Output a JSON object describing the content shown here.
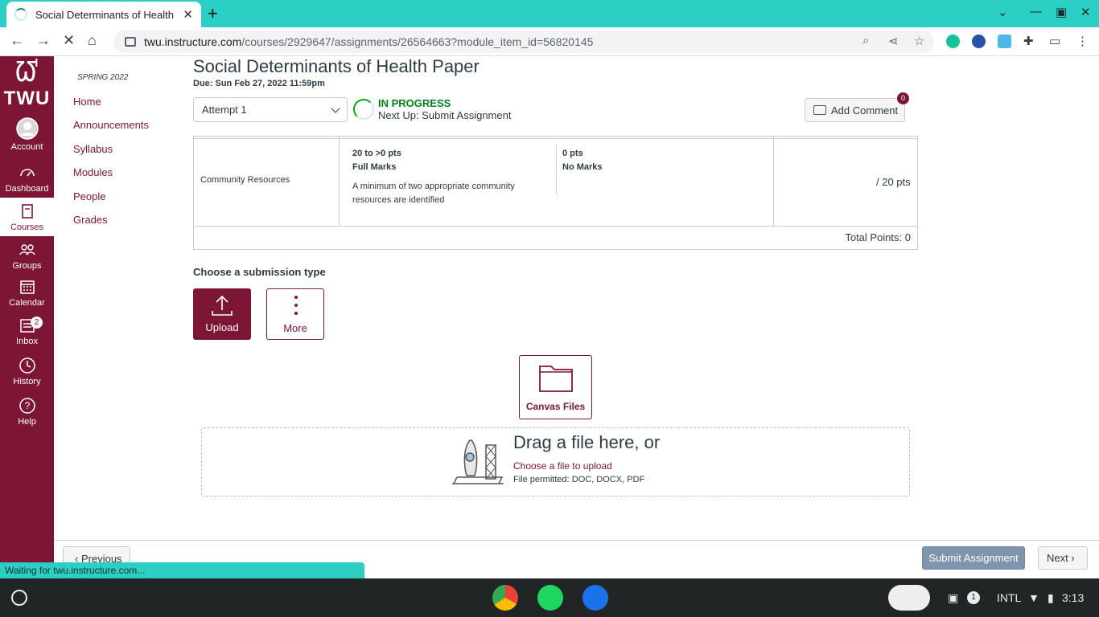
{
  "browser": {
    "tab_title": "Social Determinants of Health P",
    "url_host": "twu.instructure.com",
    "url_path": "/courses/2929647/assignments/26564663?module_item_id=56820145",
    "status_text": "Waiting for twu.instructure.com..."
  },
  "global_nav": {
    "logo_text": "TWU",
    "items": [
      {
        "label": "Account",
        "icon": "account-icon"
      },
      {
        "label": "Dashboard",
        "icon": "dashboard-icon"
      },
      {
        "label": "Courses",
        "icon": "courses-icon"
      },
      {
        "label": "Groups",
        "icon": "groups-icon"
      },
      {
        "label": "Calendar",
        "icon": "calendar-icon"
      },
      {
        "label": "Inbox",
        "icon": "inbox-icon",
        "badge": "2"
      },
      {
        "label": "History",
        "icon": "history-icon"
      },
      {
        "label": "Help",
        "icon": "help-icon"
      }
    ]
  },
  "course_nav": {
    "term": "SPRING 2022",
    "items": [
      "Home",
      "Announcements",
      "Syllabus",
      "Modules",
      "People",
      "Grades"
    ]
  },
  "assignment": {
    "title": "Social Determinants of Health Paper",
    "due": "Due: Sun Feb 27, 2022 11:59pm",
    "attempt": "Attempt 1",
    "status": "IN PROGRESS",
    "next_up": "Next Up: Submit Assignment",
    "add_comment": "Add Comment",
    "comment_count": "0"
  },
  "rubric": {
    "criterion": "Community Resources",
    "ratings": [
      {
        "pts": "20 to >0 pts",
        "label": "Full Marks",
        "desc": "A minimum of two appropriate community resources are identified"
      },
      {
        "pts": "0 pts",
        "label": "No Marks",
        "desc": ""
      }
    ],
    "points": "/ 20 pts",
    "total": "Total Points: 0"
  },
  "submission": {
    "heading": "Choose a submission type",
    "upload_label": "Upload",
    "more_label": "More",
    "canvas_files_label": "Canvas Files",
    "drag_text": "Drag a file here, or",
    "choose_link": "Choose a file to upload",
    "permitted": "File permitted: DOC, DOCX, PDF"
  },
  "footer": {
    "previous": "Previous",
    "submit": "Submit Assignment",
    "next": "Next"
  },
  "shelf": {
    "ime": "INTL",
    "notifications": "1",
    "time": "3:13"
  },
  "colors": {
    "brand": "#7d1535",
    "browser_accent": "#2ccfc3",
    "in_progress": "#00801c"
  }
}
